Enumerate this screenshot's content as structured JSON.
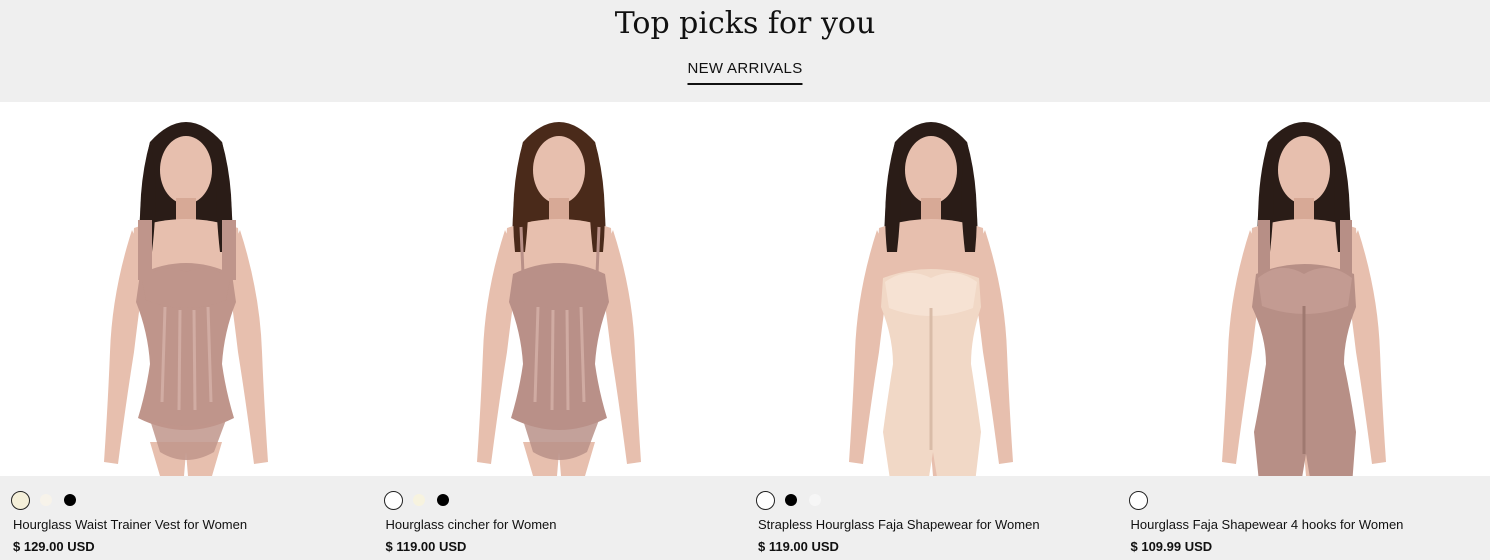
{
  "section": {
    "title": "Top picks for you",
    "tab": "NEW ARRIVALS"
  },
  "products": [
    {
      "name": "Hourglass Waist Trainer Vest for Women",
      "price": "$ 129.00 USD",
      "image_desc": "model-in-mocha-waist-trainer-vest",
      "swatches": [
        {
          "color": "#f4efd9",
          "selected": true
        },
        {
          "color": "#f7f3ea",
          "selected": false
        },
        {
          "color": "#000000",
          "selected": false
        }
      ],
      "garment_color": "#bf958b"
    },
    {
      "name": "Hourglass cincher for Women",
      "price": "$ 119.00 USD",
      "image_desc": "model-in-mocha-cincher",
      "swatches": [
        {
          "color": "#ffffff",
          "selected": true
        },
        {
          "color": "#f7f3df",
          "selected": false
        },
        {
          "color": "#000000",
          "selected": false
        }
      ],
      "garment_color": "#b99088"
    },
    {
      "name": "Strapless Hourglass Faja Shapewear for Women",
      "price": "$ 119.00 USD",
      "image_desc": "model-in-beige-strapless-faja",
      "swatches": [
        {
          "color": "#ffffff",
          "selected": true
        },
        {
          "color": "#000000",
          "selected": false
        },
        {
          "color": "#f6f6f6",
          "selected": false
        }
      ],
      "garment_color": "#f1d8c6"
    },
    {
      "name": "Hourglass Faja Shapewear 4 hooks for Women",
      "price": "$ 109.99 USD",
      "image_desc": "model-in-mocha-faja-shapewear",
      "swatches": [
        {
          "color": "#ffffff",
          "selected": true
        }
      ],
      "garment_color": "#b78f86"
    }
  ]
}
